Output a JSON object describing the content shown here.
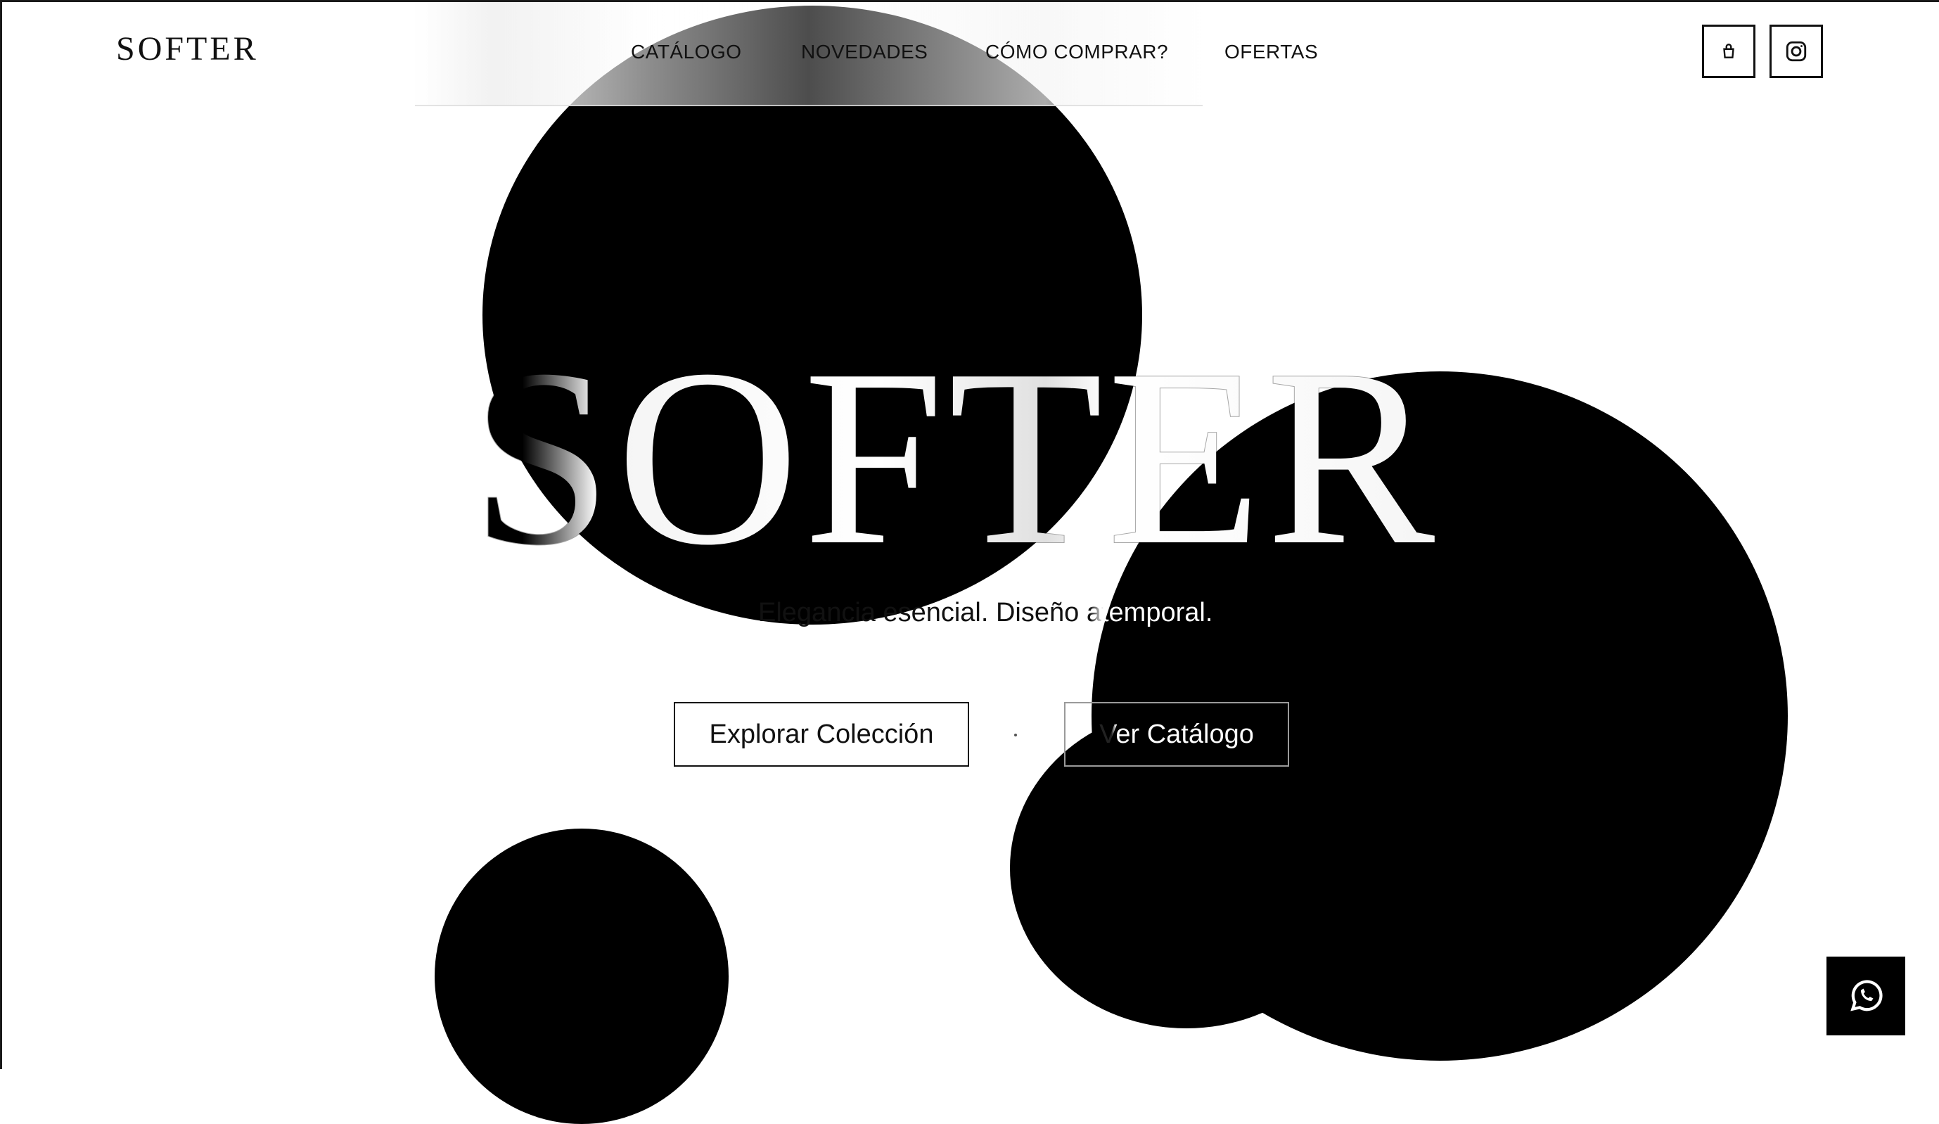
{
  "brand": {
    "logo": "SOFTER"
  },
  "nav": {
    "items": [
      {
        "label": "CATÁLOGO"
      },
      {
        "label": "NOVEDADES"
      },
      {
        "label": "CÓMO COMPRAR?"
      },
      {
        "label": "OFERTAS"
      }
    ]
  },
  "header_actions": {
    "cart_icon": "shopping-bag-icon",
    "instagram_icon": "instagram-icon"
  },
  "hero": {
    "title": "SOFTER",
    "tagline": "Elegancia esencial. Diseño atemporal.",
    "primary_cta": "Explorar Colección",
    "secondary_cta": "Ver Catálogo",
    "separator": "·"
  },
  "floating": {
    "whatsapp_icon": "whatsapp-icon"
  },
  "colors": {
    "background": "#ffffff",
    "text": "#111111",
    "orb": "#000000"
  }
}
